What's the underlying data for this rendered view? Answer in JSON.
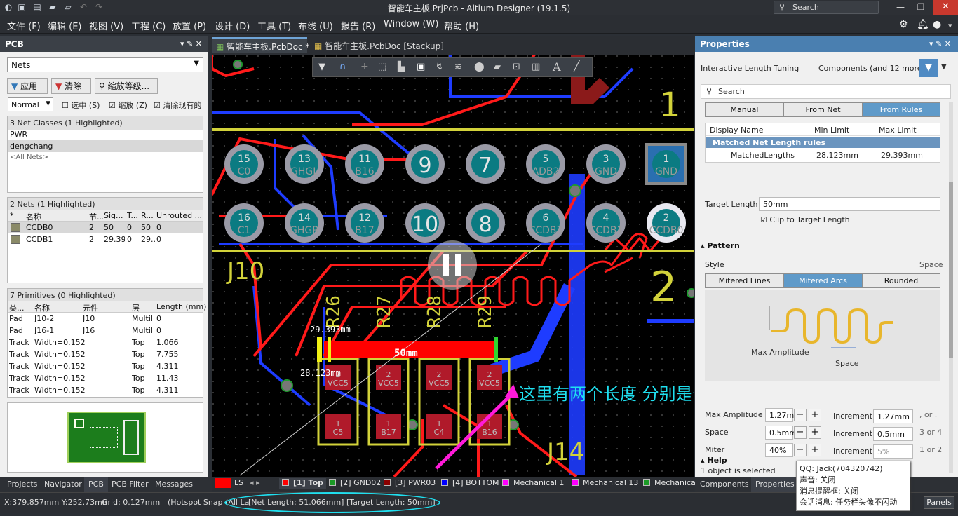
{
  "window": {
    "title": "智能车主板.PrjPcb - Altium Designer (19.1.5)",
    "search_placeholder": "Search"
  },
  "menu": [
    "文件 (F)",
    "编辑 (E)",
    "视图 (V)",
    "工程 (C)",
    "放置 (P)",
    "设计 (D)",
    "工具 (T)",
    "布线 (U)",
    "报告 (R)",
    "Window (W)",
    "帮助 (H)"
  ],
  "left_panel": {
    "title": "PCB",
    "dropdown": "Nets",
    "btn_apply": "应用",
    "btn_clear": "清除",
    "btn_zoom": "缩放等级...",
    "mode": "Normal",
    "chk_select": "选中 (S)",
    "chk_zoom": "缩放 (Z)",
    "chk_clear_existing": "清除现有的",
    "classes_header": "3 Net Classes (1 Highlighted)",
    "classes": [
      "PWR",
      "dengchang",
      "<All Nets>"
    ],
    "nets_header": "2 Nets (1 Highlighted)",
    "nets_cols": [
      "*",
      "名称",
      "节...",
      "Sig...",
      "T...",
      "R...",
      "Unrouted ..."
    ],
    "nets": [
      {
        "name": "CCDB0",
        "nodes": "2",
        "sig": "50",
        "t": "0",
        "r": "50",
        "unrouted": "0"
      },
      {
        "name": "CCDB1",
        "nodes": "2",
        "sig": "29.393",
        "t": "0",
        "r": "29...",
        "unrouted": "0"
      }
    ],
    "prims_header": "7 Primitives (0 Highlighted)",
    "prims_cols": [
      "类...",
      "名称",
      "元件",
      "层",
      "Length (mm)"
    ],
    "prims": [
      {
        "type": "Pad",
        "name": "J10-2",
        "comp": "J10",
        "layer": "Multil",
        "len": "0"
      },
      {
        "type": "Pad",
        "name": "J16-1",
        "comp": "J16",
        "layer": "Multil",
        "len": "0"
      },
      {
        "type": "Track",
        "name": "Width=0.152",
        "comp": "",
        "layer": "Top",
        "len": "1.066"
      },
      {
        "type": "Track",
        "name": "Width=0.152",
        "comp": "",
        "layer": "Top",
        "len": "7.755"
      },
      {
        "type": "Track",
        "name": "Width=0.152",
        "comp": "",
        "layer": "Top",
        "len": "4.311"
      },
      {
        "type": "Track",
        "name": "Width=0.152",
        "comp": "",
        "layer": "Top",
        "len": "11.43"
      },
      {
        "type": "Track",
        "name": "Width=0.152",
        "comp": "",
        "layer": "Top",
        "len": "4.311"
      }
    ],
    "bottom_tabs": [
      "Projects",
      "Navigator",
      "PCB",
      "PCB Filter",
      "Messages"
    ]
  },
  "doc_tabs": [
    "智能车主板.PcbDoc *",
    "智能车主板.PcbDoc [Stackup]"
  ],
  "pcb": {
    "pads_top": [
      {
        "num": "15",
        "net": "C0"
      },
      {
        "num": "13",
        "net": "GHGL"
      },
      {
        "num": "11",
        "net": "B16"
      },
      {
        "num": "9",
        "net": ""
      },
      {
        "num": "7",
        "net": ""
      },
      {
        "num": "5",
        "net": "ADB2"
      },
      {
        "num": "3",
        "net": "GND"
      },
      {
        "num": "1",
        "net": "GND"
      }
    ],
    "pads_bottom": [
      {
        "num": "16",
        "net": "C1"
      },
      {
        "num": "14",
        "net": "GHGR"
      },
      {
        "num": "12",
        "net": "B17"
      },
      {
        "num": "10",
        "net": ""
      },
      {
        "num": "8",
        "net": ""
      },
      {
        "num": "6",
        "net": "CCDB3"
      },
      {
        "num": "4",
        "net": "CCDB1"
      },
      {
        "num": "2",
        "net": "CCDB0"
      }
    ],
    "silk_j10": "J10",
    "silk_j14": "J14",
    "silk_1": "1",
    "silk_2": "2",
    "resistors": [
      "R26",
      "R27",
      "R28",
      "R29"
    ],
    "gauge_max": "29.393mm",
    "gauge_min": "28.123mm",
    "gauge_target": "50mm",
    "smd_top": [
      {
        "n": "2",
        "net": "VCC5"
      },
      {
        "n": "2",
        "net": "VCC5"
      },
      {
        "n": "2",
        "net": "VCC5"
      },
      {
        "n": "2",
        "net": "VCC5"
      }
    ],
    "smd_bot": [
      {
        "n": "1",
        "net": "C5"
      },
      {
        "n": "1",
        "net": "B17"
      },
      {
        "n": "1",
        "net": "C4"
      },
      {
        "n": "1",
        "net": "B16"
      }
    ],
    "annotation": "这里有两个长度 分别是什么含义？"
  },
  "layers": {
    "ls": "LS",
    "items": [
      {
        "label": "[1] Top",
        "color": "#ff0000"
      },
      {
        "label": "[2] GND02",
        "color": "#1b9a26"
      },
      {
        "label": "[3] PWR03",
        "color": "#8b0000"
      },
      {
        "label": "[4] BOTTOM",
        "color": "#0000ff"
      },
      {
        "label": "Mechanical 1",
        "color": "#ff00ff"
      },
      {
        "label": "Mechanical 13",
        "color": "#ff00ff"
      },
      {
        "label": "Mechanica",
        "color": "#1b9a26"
      }
    ]
  },
  "props": {
    "title": "Properties",
    "mode": "Interactive Length Tuning",
    "filter": "Components (and 12 more)",
    "search_placeholder": "Search",
    "source_tabs": [
      "Manual",
      "From Net",
      "From Rules"
    ],
    "table_cols": [
      "Display Name",
      "Min Limit",
      "Max Limit"
    ],
    "table_group": "Matched Net Length rules",
    "table_row": {
      "name": "MatchedLengths",
      "min": "28.123mm",
      "max": "29.393mm"
    },
    "target_label": "Target Length",
    "target_value": "50mm",
    "clip": "Clip to Target Length",
    "pattern_header": "Pattern",
    "style_label": "Style",
    "space_label_right": "Space",
    "styles": [
      "Mitered Lines",
      "Mitered Arcs",
      "Rounded"
    ],
    "diag_max": "Max Amplitude",
    "diag_space": "Space",
    "rows": [
      {
        "label": "Max Amplitude",
        "value": "1.27mm",
        "inc_label": "Increment",
        "inc": "1.27mm",
        "hint": ", or ."
      },
      {
        "label": "Space",
        "value": "0.5mm",
        "inc_label": "Increment",
        "inc": "0.5mm",
        "hint": "3 or 4"
      },
      {
        "label": "Miter",
        "value": "40%",
        "inc_label": "Increment",
        "inc": "5%",
        "hint": "1 or 2"
      }
    ],
    "help_header": "Help",
    "selected": "1 object is selected",
    "bottom_tabs": [
      "Components",
      "Properties"
    ]
  },
  "qq_popup": {
    "line1": "QQ: Jack(704320742)",
    "line2": "声音: 关闭",
    "line3": "消息提醒框: 关闭",
    "line4": "会话消息: 任务栏头像不闪动"
  },
  "status": {
    "coords": "X:379.857mm Y:252.73mm",
    "grid": "Grid: 0.127mm",
    "snap": "(Hotspot Snap (All La",
    "netlen": "[Net Length: 51.066mm] [Target Length:  50mm]",
    "panels": "Panels"
  }
}
